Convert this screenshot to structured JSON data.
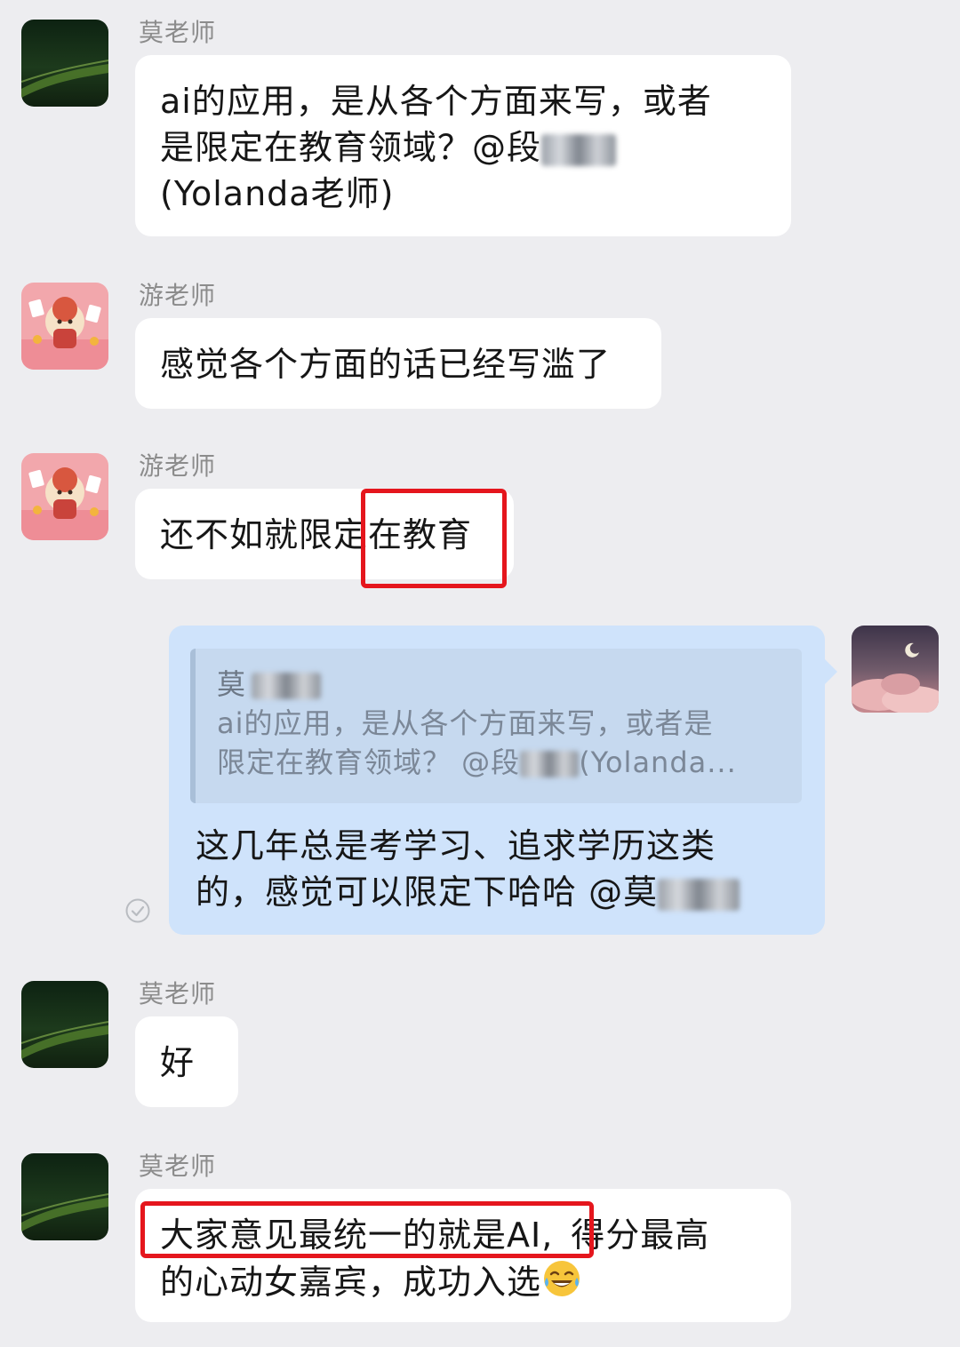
{
  "messages": [
    {
      "sender": "莫老师",
      "lines": [
        "ai的应用，是从各个方面来写，或者",
        "是限定在教育领域？@段",
        "(Yolanda老师)"
      ]
    },
    {
      "sender": "游老师",
      "lines": [
        "感觉各个方面的话已经写滥了"
      ]
    },
    {
      "sender": "游老师",
      "text": "还不如就限定在教育"
    },
    {
      "quote_name": "莫",
      "quote_lines": [
        "ai的应用，是从各个方面来写，或者是",
        "限定在教育领域？ @段",
        "(Yolanda..."
      ],
      "lines": [
        "这几年总是考学习、追求学历这类",
        "的，感觉可以限定下哈哈 @莫"
      ]
    },
    {
      "sender": "莫老师",
      "text": "好"
    },
    {
      "sender": "莫老师",
      "highlight_text": "大家意见最统一的就是AI,",
      "rest_text": "得分最高",
      "line2": "的心动女嘉宾，成功入选"
    }
  ],
  "icons": {
    "sent_status": "check-circle-icon",
    "emoji": "tears-of-joy-emoji"
  },
  "colors": {
    "highlight": "#e5161d",
    "my_bubble": "#cfe3fb",
    "background": "#ededf0"
  }
}
